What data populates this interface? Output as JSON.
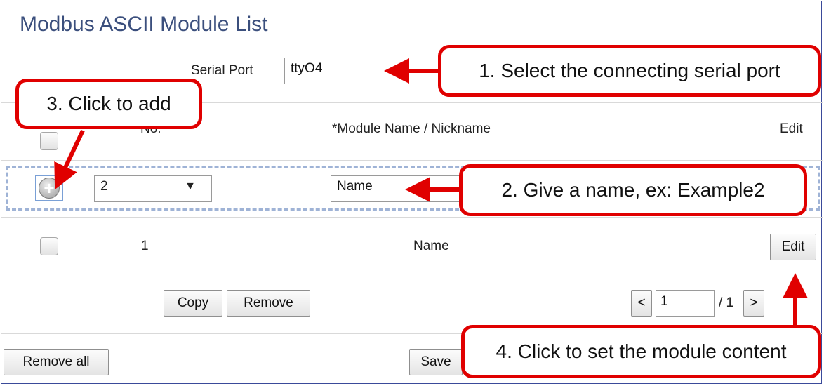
{
  "page": {
    "title": "Modbus ASCII Module List"
  },
  "serial": {
    "label": "Serial Port",
    "value": "ttyO4"
  },
  "table": {
    "headers": {
      "no": "No.",
      "name": "*Module Name / Nickname",
      "edit": "Edit"
    },
    "new_row": {
      "no_value": "2",
      "no_arrow": "▼",
      "name_value": "Name",
      "add_icon": "+"
    },
    "rows": [
      {
        "no": "1",
        "name": "Name",
        "edit_label": "Edit"
      }
    ]
  },
  "actions": {
    "copy": "Copy",
    "remove": "Remove",
    "remove_all": "Remove all",
    "save": "Save"
  },
  "pagination": {
    "prev": "<",
    "next": ">",
    "current": "1",
    "total": "/ 1"
  },
  "callouts": {
    "c1": "1. Select the connecting serial port",
    "c2": "2. Give a name, ex: Example2",
    "c3": "3. Click to add",
    "c4": "4. Click to set the module content"
  },
  "colors": {
    "callout_border": "#e00000",
    "title": "#3b4f7d",
    "new_row_border": "#9fb3d6"
  }
}
